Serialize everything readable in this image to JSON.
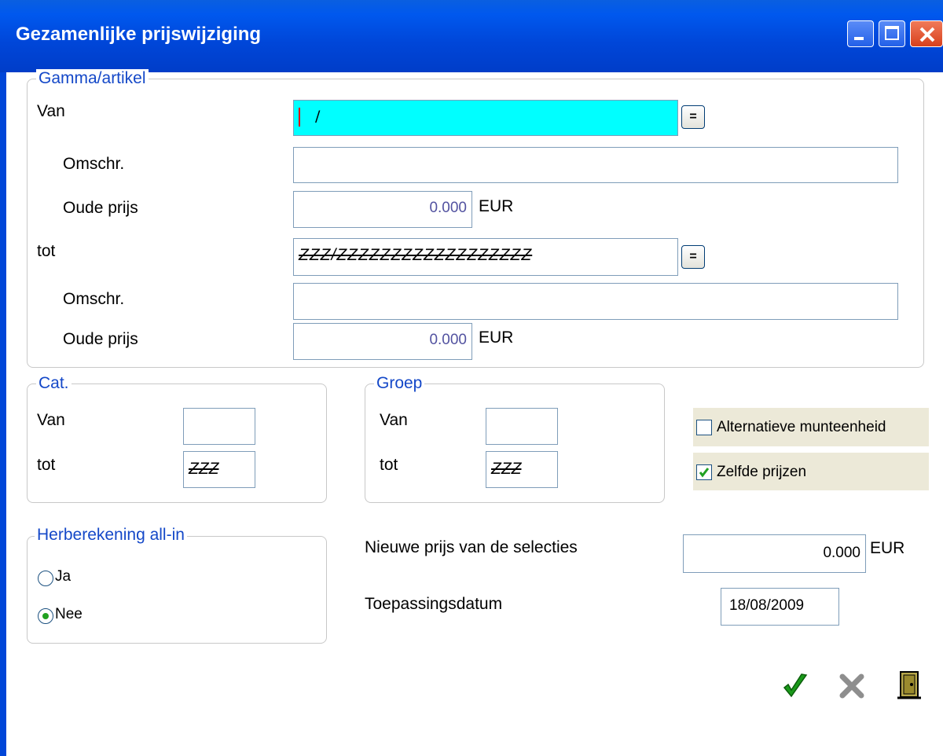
{
  "window": {
    "title": "Gezamenlijke prijswijziging"
  },
  "gamma": {
    "legend": "Gamma/artikel",
    "van_label": "Van",
    "van_value": "/",
    "omschr_label": "Omschr.",
    "omschr1_value": "",
    "oude_prijs_label": "Oude prijs",
    "oude_prijs1_value": "0.000",
    "currency": "EUR",
    "tot_label": "tot",
    "tot_value": "ZZZ/ZZZZZZZZZZZZZZZZZZ",
    "omschr2_value": "",
    "oude_prijs2_value": "0.000",
    "lookup_button": "="
  },
  "cat": {
    "legend": "Cat.",
    "van_label": "Van",
    "van_value": "",
    "tot_label": "tot",
    "tot_value": "ZZZ"
  },
  "groep": {
    "legend": "Groep",
    "van_label": "Van",
    "van_value": "",
    "tot_label": "tot",
    "tot_value": "ZZZ"
  },
  "options": {
    "alt_currency_label": "Alternatieve munteenheid",
    "alt_currency_checked": false,
    "same_prices_label": "Zelfde prijzen",
    "same_prices_checked": true
  },
  "herberekening": {
    "legend": "Herberekening all-in",
    "ja_label": "Ja",
    "nee_label": "Nee",
    "selected": "Nee"
  },
  "new_price": {
    "label": "Nieuwe prijs van de selecties",
    "value": "0.000",
    "currency": "EUR"
  },
  "apply_date": {
    "label": "Toepassingsdatum",
    "value": "18/08/2009"
  },
  "colors": {
    "titlebar": "#0046d8",
    "highlight_field": "#00ffff",
    "legend_text": "#1448c8",
    "ok_green": "#1a9a1a"
  },
  "actions": {
    "confirm_icon": "checkmark-icon",
    "cancel_icon": "cross-icon",
    "exit_icon": "door-icon"
  }
}
